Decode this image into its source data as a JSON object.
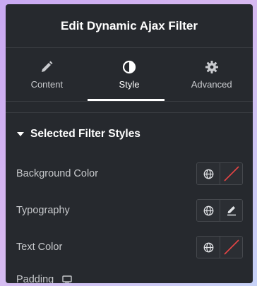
{
  "header": {
    "title": "Edit Dynamic Ajax Filter"
  },
  "tabs": [
    {
      "label": "Content",
      "icon": "pencil-icon",
      "active": false
    },
    {
      "label": "Style",
      "icon": "half-circle-contrast-icon",
      "active": true
    },
    {
      "label": "Advanced",
      "icon": "gear-icon",
      "active": false
    }
  ],
  "section": {
    "title": "Selected Filter Styles",
    "expanded": true
  },
  "controls": [
    {
      "label": "Background Color",
      "buttons": [
        "globe-icon",
        "no-color-slash-icon"
      ]
    },
    {
      "label": "Typography",
      "buttons": [
        "globe-icon",
        "edit-pencil-icon"
      ]
    },
    {
      "label": "Text Color",
      "buttons": [
        "globe-icon",
        "no-color-slash-icon"
      ]
    }
  ],
  "padding": {
    "label": "Padding",
    "icon": "desktop-monitor-icon"
  },
  "colors": {
    "panel_bg": "#26292e",
    "slash_red": "#e84545",
    "text": "#c7c9cc"
  }
}
